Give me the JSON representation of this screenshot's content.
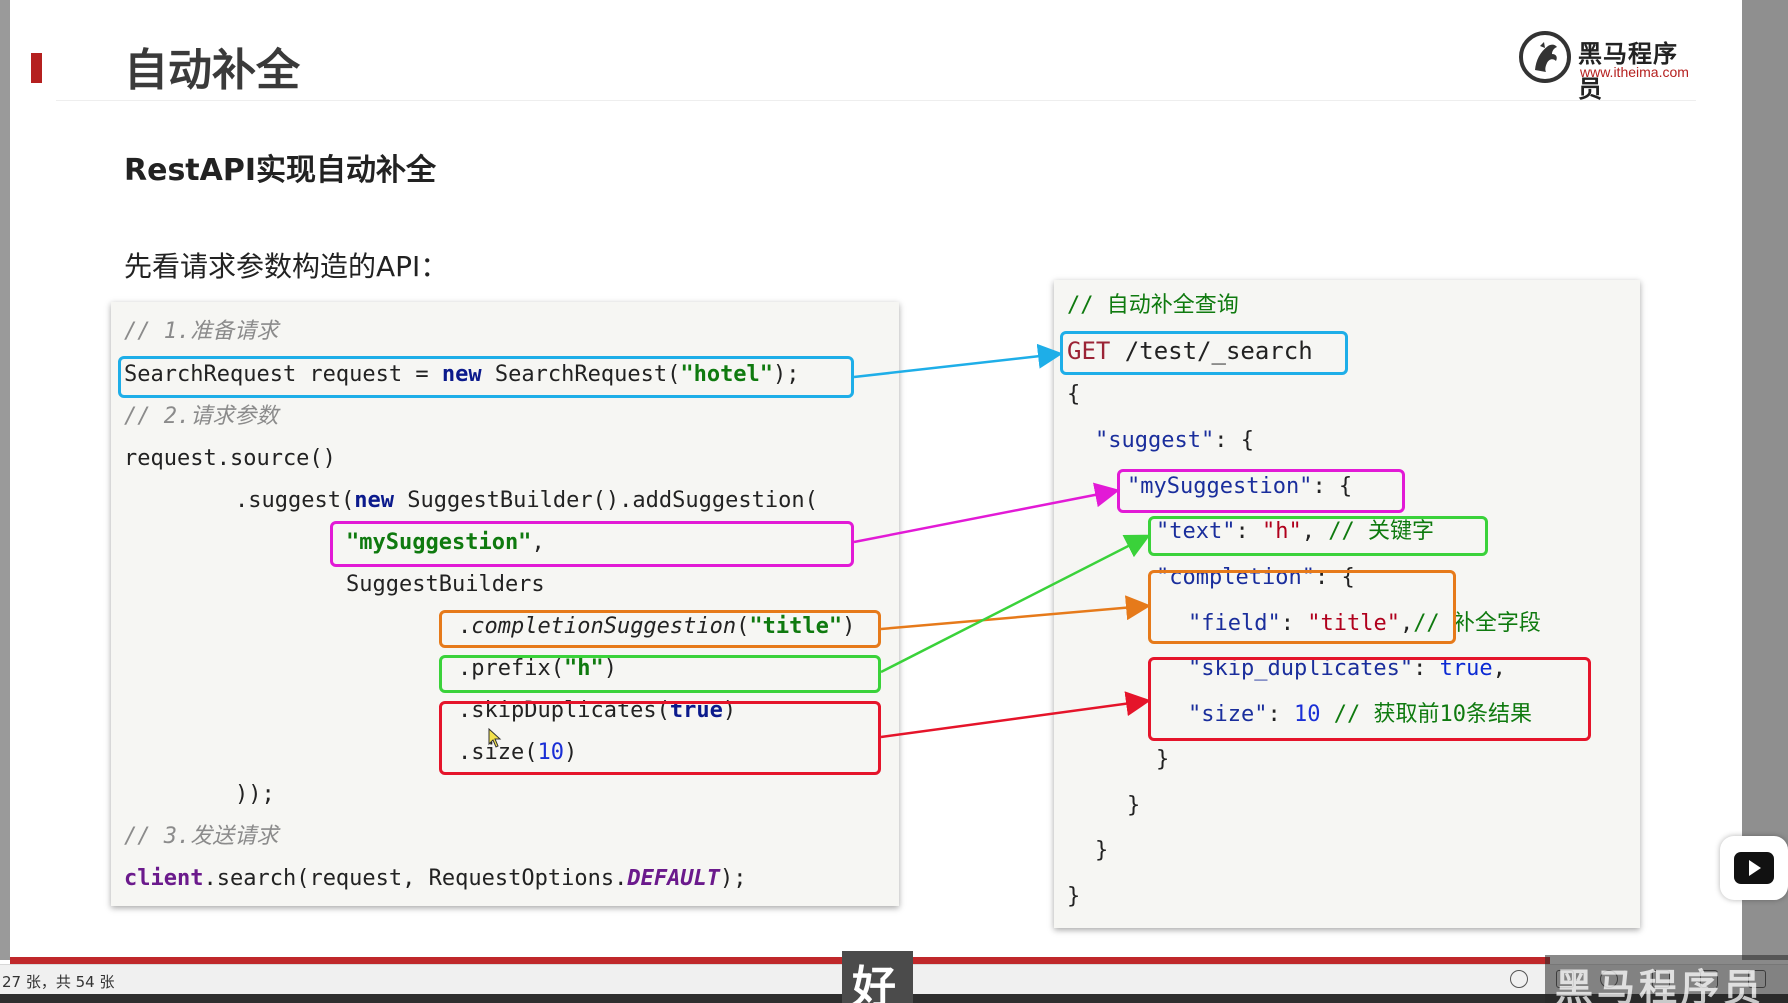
{
  "slide": {
    "title": "自动补全",
    "subtitle": "RestAPI实现自动补全",
    "intro": "先看请求参数构造的API："
  },
  "logo": {
    "name": "黑马程序员",
    "url": "www.itheima.com"
  },
  "java_code": {
    "c1": "// 1.准备请求",
    "l1_a": "SearchRequest request = ",
    "l1_kw": "new",
    "l1_b": " SearchRequest(",
    "l1_str": "\"hotel\"",
    "l1_c": ");",
    "c2": "// 2.请求参数",
    "l2": "request.source()",
    "l3_a": ".suggest(",
    "l3_kw": "new",
    "l3_b": " SuggestBuilder().addSuggestion(",
    "l4_str": "\"mySuggestion\"",
    "l4_c": ",",
    "l5": "SuggestBuilders",
    "l6_a": ".",
    "l6_it": "completionSuggestion",
    "l6_b": "(",
    "l6_str": "\"title\"",
    "l6_c": ")",
    "l7_a": ".prefix(",
    "l7_str": "\"h\"",
    "l7_c": ")",
    "l8_a": ".skipDuplicates(",
    "l8_kw": "true",
    "l8_c": ")",
    "l9_a": ".size(",
    "l9_num": "10",
    "l9_c": ")",
    "l10": "));",
    "c3": "// 3.发送请求",
    "l11_kw": "client",
    "l11_a": ".search(request, RequestOptions.",
    "l11_pu": "DEFAULT",
    "l11_c": ");"
  },
  "json_code": {
    "c1": "// 自动补全查询",
    "get": "GET",
    "path": " /test/_search",
    "open": "{",
    "suggest_key": "\"suggest\"",
    "suggest_rest": ": {",
    "my_key": "\"mySuggestion\"",
    "my_rest": ": {",
    "text_key": "\"text\"",
    "text_sep": ": ",
    "text_val": "\"h\"",
    "text_comma": ", ",
    "text_cm": "// 关键字",
    "comp_key": "\"completion\"",
    "comp_rest": ": {",
    "field_key": "\"field\"",
    "field_sep": ": ",
    "field_val": "\"title\"",
    "field_comma": ",",
    "field_cm": "// 补全字段",
    "skip_key": "\"skip_duplicates\"",
    "skip_sep": ": ",
    "skip_val": "true",
    "skip_comma": ",",
    "size_key": "\"size\"",
    "size_sep": ": ",
    "size_val": "10",
    "size_cm": " // 获取前10条结果",
    "close1": "}",
    "close2": "}",
    "close3": "}",
    "close4": "}"
  },
  "status": {
    "slide_counter": "27 张，共 54 张"
  },
  "overlays": {
    "thumb_char": "好",
    "watermark": "黑马程序员"
  },
  "colors": {
    "accent_red": "#b5201f",
    "blue": "#1eaee8",
    "magenta": "#e21ad6",
    "orange": "#e67a1a",
    "green": "#3ad23a",
    "red": "#e5142a"
  }
}
